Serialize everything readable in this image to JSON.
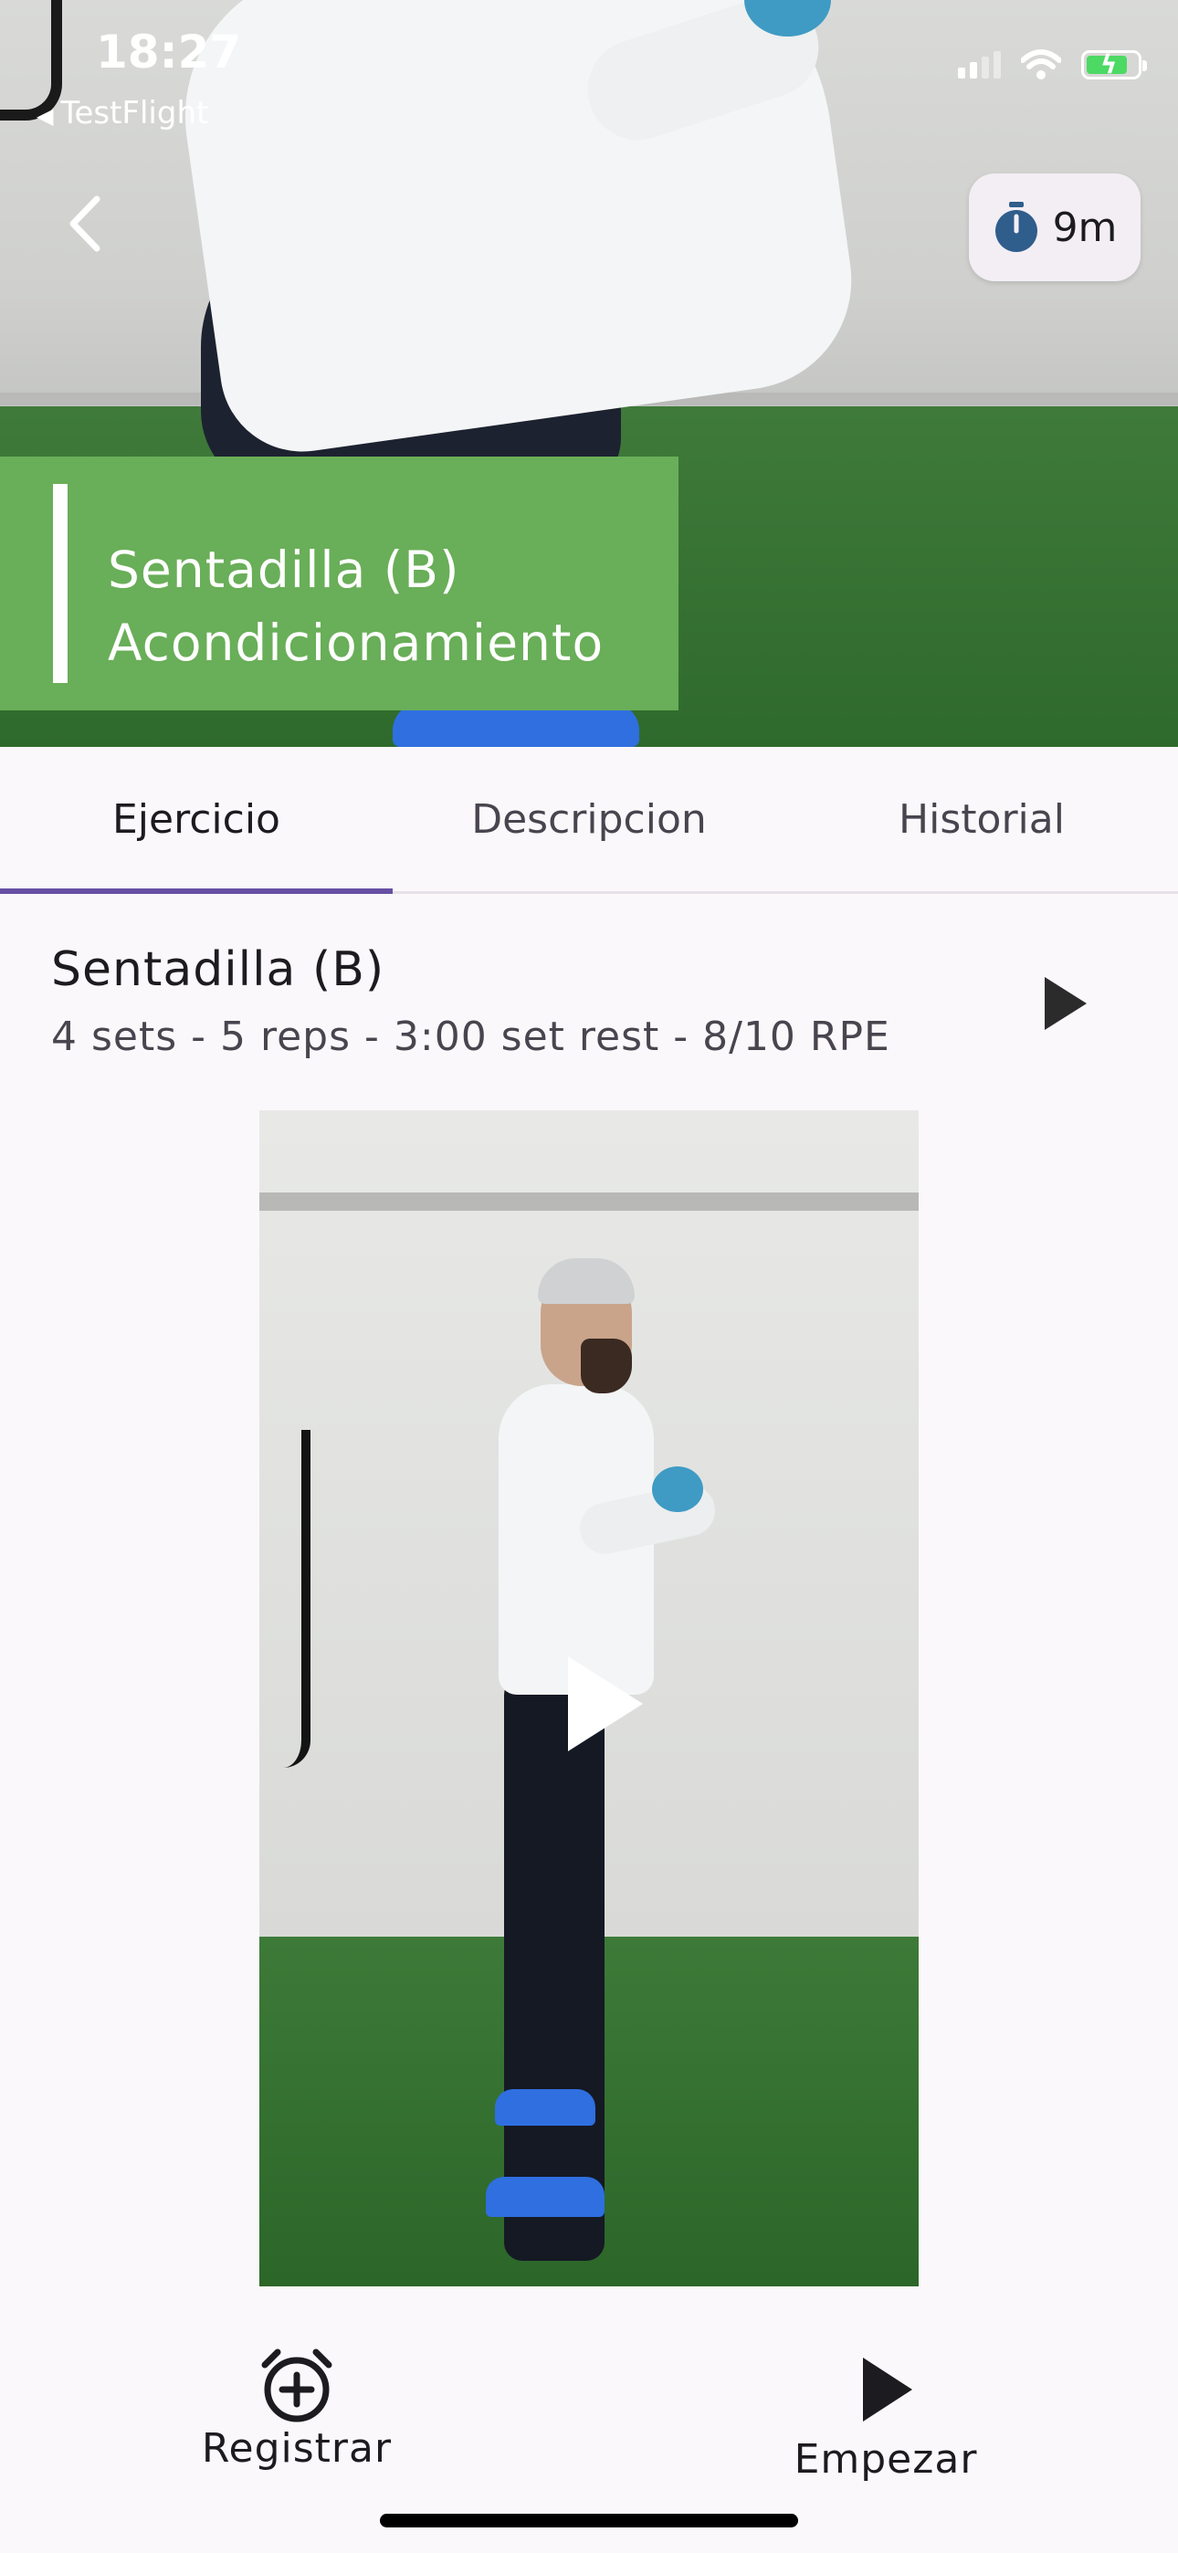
{
  "status_bar": {
    "time": "18:27",
    "back_app": "TestFlight",
    "icons": [
      "signal-icon",
      "wifi-icon",
      "battery-charging-icon"
    ]
  },
  "header": {
    "back_icon": "chevron-left-icon",
    "timer_icon": "stopwatch-icon",
    "timer_label": "9m",
    "title": "Sentadilla (B)",
    "subtitle": "Acondicionamiento",
    "banner_color": "#69ae58"
  },
  "tabs": [
    {
      "label": "Ejercicio",
      "active": true
    },
    {
      "label": "Descripcion",
      "active": false
    },
    {
      "label": "Historial",
      "active": false
    }
  ],
  "exercise": {
    "name": "Sentadilla (B)",
    "meta": "4 sets - 5 reps - 3:00 set rest - 8/10 RPE",
    "play_icon": "play-icon"
  },
  "video": {
    "play_icon": "play-icon"
  },
  "actions": {
    "registrar_label": "Registrar",
    "registrar_icon": "alarm-add-icon",
    "empezar_label": "Empezar",
    "empezar_icon": "play-icon"
  },
  "colors": {
    "accent": "#6750a4",
    "banner": "#69ae58",
    "background": "#fbf8fb"
  }
}
